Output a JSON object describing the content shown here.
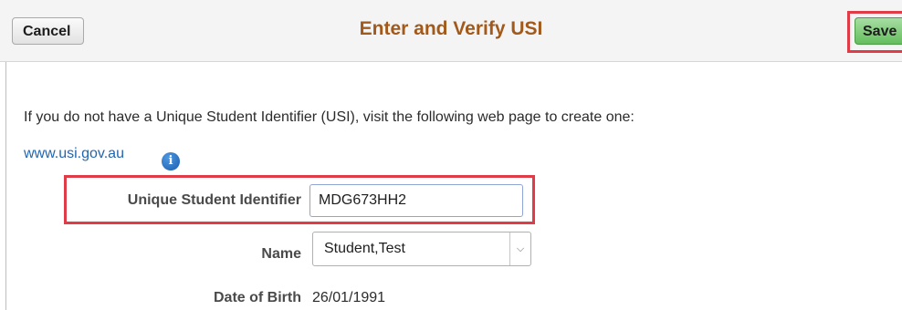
{
  "header": {
    "title": "Enter and Verify USI",
    "cancel_label": "Cancel",
    "save_label": "Save"
  },
  "intro_text": "If you do not have a Unique Student Identifier (USI), visit the following web page to create one:",
  "usi_link": {
    "label": "www.usi.gov.au",
    "info_icon": "info-icon"
  },
  "form": {
    "usi_label": "Unique Student Identifier",
    "usi_value": "MDG673HH2",
    "name_label": "Name",
    "name_selected": "Student,Test",
    "dob_label": "Date of Birth",
    "dob_value": "26/01/1991"
  },
  "colors": {
    "title": "#a15a1b",
    "highlight": "#e03c48",
    "save_button": "#64be5d",
    "link": "#2266b0"
  }
}
